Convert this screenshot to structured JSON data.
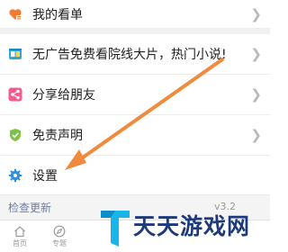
{
  "menu": {
    "items": [
      {
        "label": "我的看单",
        "icon": "heart-list-icon",
        "color": "#f47a33"
      },
      {
        "label": "无广告免费看院线大片，热门小说!",
        "icon": "book-store-icon",
        "color": "#2fa7d7"
      },
      {
        "label": "分享给朋友",
        "icon": "share-icon",
        "color": "#f25b8b"
      },
      {
        "label": "免责声明",
        "icon": "shield-icon",
        "color": "#7dc243"
      },
      {
        "label": "设置",
        "icon": "gear-icon",
        "color": "#2d8fe0"
      }
    ]
  },
  "footer": {
    "check_update": "检查更新",
    "version": "v3.2"
  },
  "bottom_nav": {
    "items": [
      {
        "label": "首页",
        "icon": "home-icon"
      },
      {
        "label": "专题",
        "icon": "compass-icon"
      }
    ]
  },
  "watermark": {
    "text": "天天游戏网",
    "logo": "letter-t-logo"
  },
  "annotation": {
    "arrow_color": "#f08a3c"
  }
}
